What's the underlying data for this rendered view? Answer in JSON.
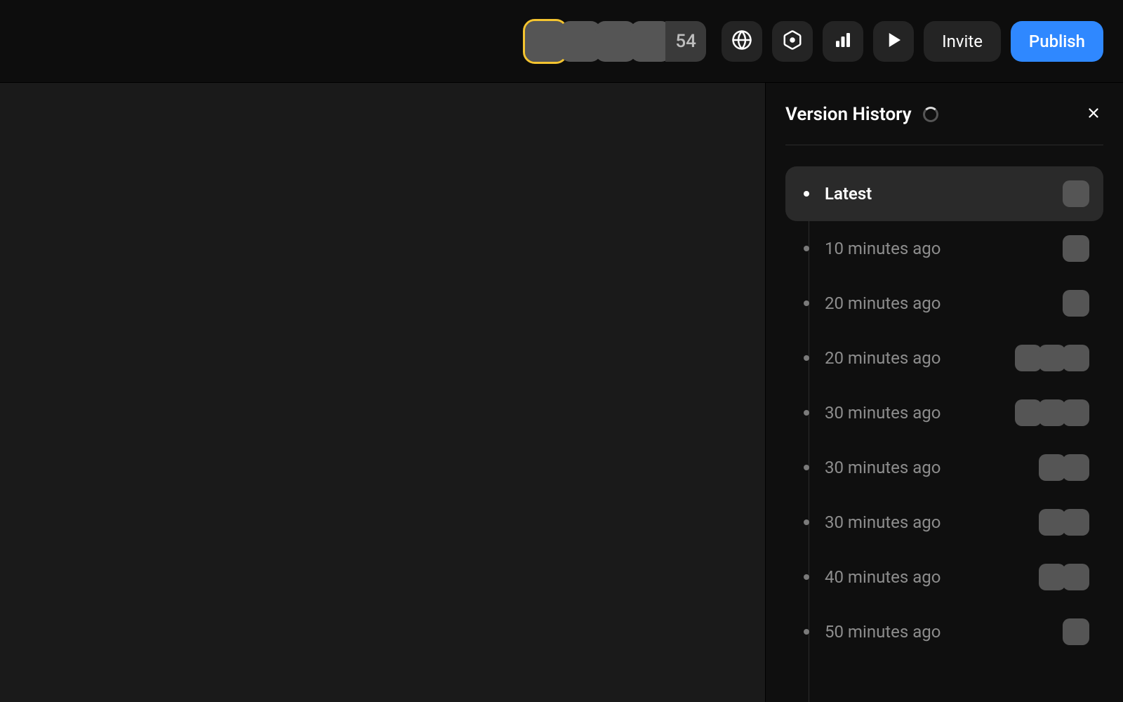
{
  "topbar": {
    "presence_overflow": "54",
    "invite_label": "Invite",
    "publish_label": "Publish",
    "icons": {
      "globe": "globe-icon",
      "component": "component-icon",
      "analytics": "analytics-icon",
      "play": "play-icon"
    }
  },
  "panel": {
    "title": "Version History"
  },
  "history": [
    {
      "label": "Latest",
      "selected": true,
      "avatars": [
        "b"
      ]
    },
    {
      "label": "10 minutes ago",
      "selected": false,
      "avatars": [
        "b"
      ]
    },
    {
      "label": "20 minutes ago",
      "selected": false,
      "avatars": [
        "b"
      ]
    },
    {
      "label": "20 minutes ago",
      "selected": false,
      "avatars": [
        "b",
        "d",
        "e"
      ]
    },
    {
      "label": "30 minutes ago",
      "selected": false,
      "avatars": [
        "b",
        "c",
        "d"
      ]
    },
    {
      "label": "30 minutes ago",
      "selected": false,
      "avatars": [
        "b",
        "d"
      ]
    },
    {
      "label": "30 minutes ago",
      "selected": false,
      "avatars": [
        "b",
        "d"
      ]
    },
    {
      "label": "40 minutes ago",
      "selected": false,
      "avatars": [
        "b",
        "d"
      ]
    },
    {
      "label": "50 minutes ago",
      "selected": false,
      "avatars": [
        "d"
      ]
    }
  ]
}
